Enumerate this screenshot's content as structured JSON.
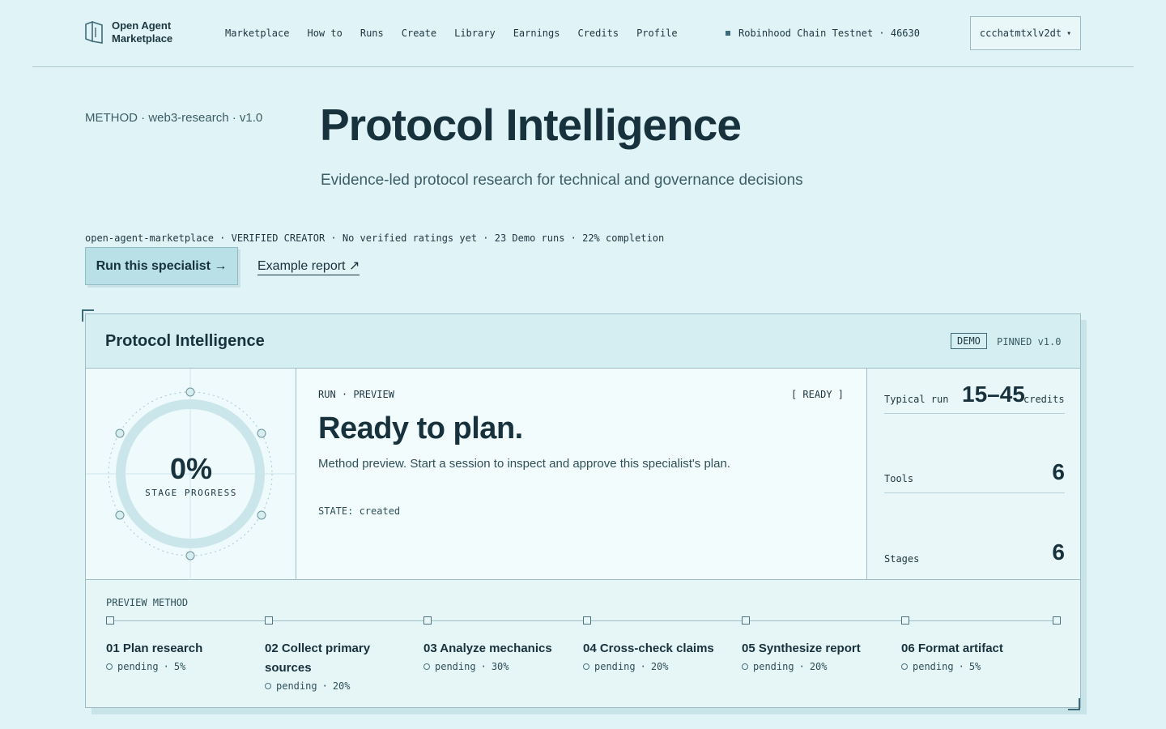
{
  "nav": {
    "logo_line1": "Open Agent",
    "logo_line2": "Marketplace",
    "links": [
      "Marketplace",
      "How to",
      "Runs",
      "Create",
      "Library",
      "Earnings",
      "Credits",
      "Profile"
    ],
    "network": "Robinhood Chain Testnet · 46630",
    "wallet": "ccchatmtxlv2dt",
    "wallet_caret": "▾"
  },
  "hero": {
    "method_tag": "METHOD · web3-research · v1.0",
    "title": "Protocol Intelligence",
    "subtitle": "Evidence-led protocol research for technical and governance decisions",
    "meta": "open-agent-marketplace · VERIFIED CREATOR · No verified ratings yet · 23 Demo runs · 22% completion",
    "run_button": "Run this specialist →",
    "example_link": "Example report ↗"
  },
  "card": {
    "title": "Protocol Intelligence",
    "badge": "DEMO",
    "pinned": "PINNED v1.0",
    "progress_value": "0%",
    "progress_label": "STAGE PROGRESS",
    "run_kicker": "RUN · PREVIEW",
    "run_status": "[ READY ]",
    "run_title": "Ready to plan.",
    "run_desc": "Method preview. Start a session to inspect and approve this specialist's plan.",
    "run_state": "STATE: created",
    "stats": {
      "typical_label": "Typical run",
      "typical_value": "15–45",
      "typical_unit": "credits",
      "tools_label": "Tools",
      "tools_value": "6",
      "stages_label": "Stages",
      "stages_value": "6"
    },
    "preview_label": "PREVIEW METHOD",
    "steps": [
      {
        "name": "01 Plan research",
        "status": "pending",
        "weight": "5%"
      },
      {
        "name": "02 Collect primary sources",
        "status": "pending",
        "weight": "20%"
      },
      {
        "name": "03 Analyze mechanics",
        "status": "pending",
        "weight": "30%"
      },
      {
        "name": "04 Cross-check claims",
        "status": "pending",
        "weight": "20%"
      },
      {
        "name": "05 Synthesize report",
        "status": "pending",
        "weight": "20%"
      },
      {
        "name": "06 Format artifact",
        "status": "pending",
        "weight": "5%"
      }
    ]
  }
}
